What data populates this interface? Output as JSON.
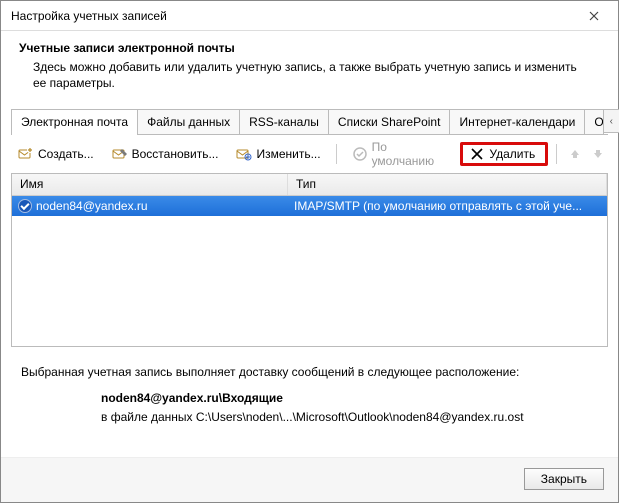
{
  "window": {
    "title": "Настройка учетных записей"
  },
  "header": {
    "title": "Учетные записи электронной почты",
    "description": "Здесь можно добавить или удалить учетную запись, а также выбрать учетную запись и изменить ее параметры."
  },
  "tabs": {
    "items": [
      {
        "label": "Электронная почта"
      },
      {
        "label": "Файлы данных"
      },
      {
        "label": "RSS-каналы"
      },
      {
        "label": "Списки SharePoint"
      },
      {
        "label": "Интернет-календари"
      },
      {
        "label": "Опубликованные календари"
      }
    ],
    "nav_prev": "‹",
    "nav_next": "›"
  },
  "toolbar": {
    "create": "Создать...",
    "restore": "Восстановить...",
    "edit": "Изменить...",
    "default": "По умолчанию",
    "delete": "Удалить"
  },
  "table": {
    "columns": {
      "name": "Имя",
      "type": "Тип"
    },
    "rows": [
      {
        "name": "noden84@yandex.ru",
        "type": "IMAP/SMTP (по умолчанию отправлять с этой уче..."
      }
    ]
  },
  "delivery": {
    "intro": "Выбранная учетная запись выполняет доставку сообщений в следующее расположение:",
    "location": "noden84@yandex.ru\\Входящие",
    "path": "в файле данных C:\\Users\\noden\\...\\Microsoft\\Outlook\\noden84@yandex.ru.ost"
  },
  "footer": {
    "close": "Закрыть"
  }
}
